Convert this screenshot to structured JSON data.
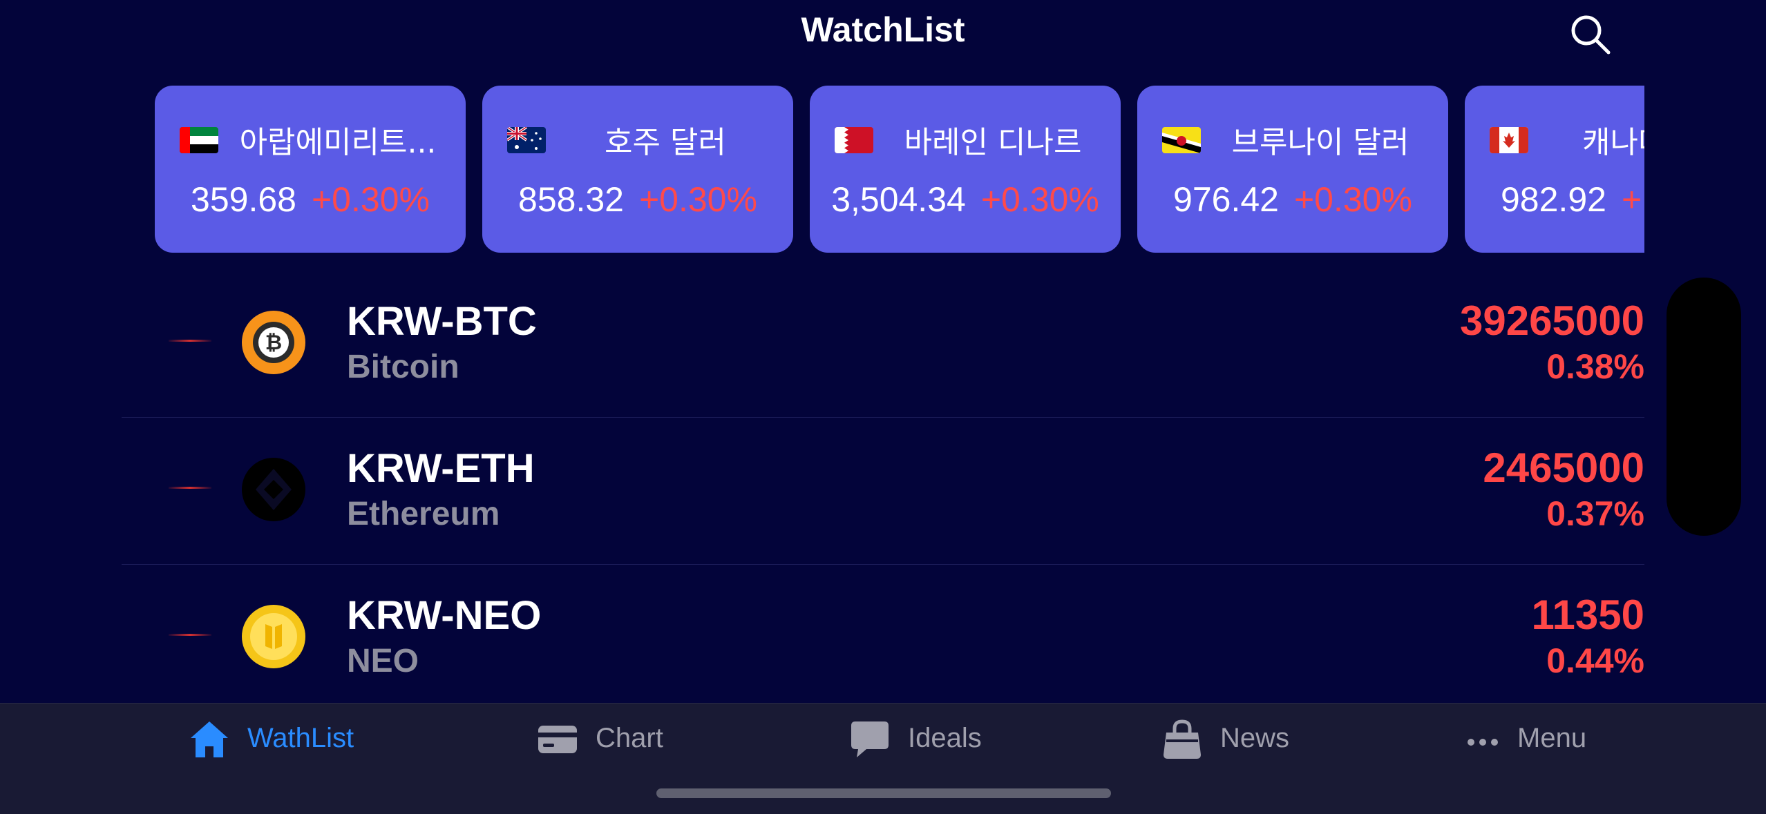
{
  "header": {
    "title": "WatchList",
    "search_icon": "search-icon"
  },
  "currency_cards": [
    {
      "name": "아랍에미리트...",
      "value": "359.68",
      "change": "+0.30%",
      "flag": "uae-flag-icon"
    },
    {
      "name": "호주 달러",
      "value": "858.32",
      "change": "+0.30%",
      "flag": "australia-flag-icon"
    },
    {
      "name": "바레인 디나르",
      "value": "3,504.34",
      "change": "+0.30%",
      "flag": "bahrain-flag-icon"
    },
    {
      "name": "브루나이 달러",
      "value": "976.42",
      "change": "+0.30%",
      "flag": "brunei-flag-icon"
    },
    {
      "name": "캐나다",
      "value": "982.92",
      "change": "+",
      "flag": "canada-flag-icon"
    }
  ],
  "coins": [
    {
      "symbol": "KRW-BTC",
      "name": "Bitcoin",
      "price": "39265000",
      "change": "0.38%",
      "icon": "bitcoin-icon"
    },
    {
      "symbol": "KRW-ETH",
      "name": "Ethereum",
      "price": "2465000",
      "change": "0.37%",
      "icon": "ethereum-icon"
    },
    {
      "symbol": "KRW-NEO",
      "name": "NEO",
      "price": "11350",
      "change": "0.44%",
      "icon": "neo-icon"
    }
  ],
  "tabs": [
    {
      "label": "WathList",
      "icon": "home-icon",
      "active": true
    },
    {
      "label": "Chart",
      "icon": "card-icon",
      "active": false
    },
    {
      "label": "Ideals",
      "icon": "chat-bubble-icon",
      "active": false
    },
    {
      "label": "News",
      "icon": "bag-icon",
      "active": false
    },
    {
      "label": "Menu",
      "icon": "more-dots-icon",
      "active": false
    }
  ],
  "colors": {
    "background": "#03043a",
    "card": "#5b5be6",
    "negative_red": "#ff4747",
    "active_tab": "#2a8cff",
    "tabbar": "#191a34"
  }
}
